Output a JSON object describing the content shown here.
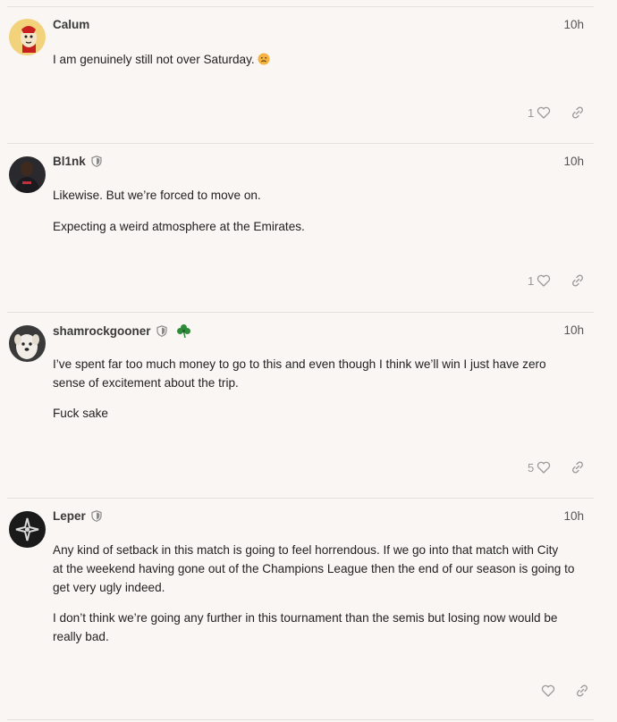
{
  "posts": [
    {
      "username": "Calum",
      "time": "10h",
      "moderator": false,
      "flair": "",
      "paragraphs": [
        "I am genuinely still not over Saturday."
      ],
      "emoji": "frowning-face-emoji",
      "likes": "1"
    },
    {
      "username": "Bl1nk",
      "time": "10h",
      "moderator": true,
      "flair": "",
      "paragraphs": [
        "Likewise. But we’re forced to move on.",
        "Expecting a weird atmosphere at the Emirates."
      ],
      "likes": "1"
    },
    {
      "username": "shamrockgooner",
      "time": "10h",
      "moderator": true,
      "flair": "shamrock-icon",
      "paragraphs": [
        "I’ve spent far too much money to go to this and even though I think we’ll win I just have zero",
        "sense of excitement about the trip.",
        "Fuck sake"
      ],
      "likes": "5"
    },
    {
      "username": "Leper",
      "time": "10h",
      "moderator": true,
      "flair": "",
      "paragraphs": [
        "Any kind of setback in this match is going to feel horrendous. If we go into that match with City",
        "at the weekend having gone out of the Champions League then the end of our season is going to",
        "get very ugly indeed.",
        "I don’t think we’re going any further in this tournament than the semis but losing now would be",
        "really bad."
      ],
      "likes": ""
    }
  ],
  "colors": {
    "background": "#faf6f3",
    "divider": "#e6e1dd",
    "meta": "#999999",
    "shamrock": "#2e8b3a"
  }
}
